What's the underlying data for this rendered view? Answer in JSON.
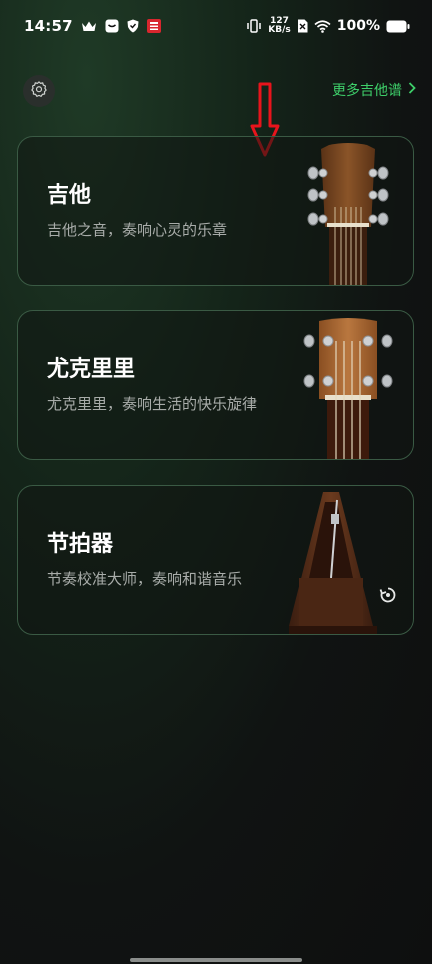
{
  "status_bar": {
    "time": "14:57",
    "net_speed_value": "127",
    "net_speed_unit": "KB/s",
    "battery": "100%"
  },
  "header": {
    "more_tabs_label": "更多吉他谱",
    "chevron": "chevron-right-icon",
    "settings": "gear-icon"
  },
  "cards": [
    {
      "title": "吉他",
      "subtitle": "吉他之音，奏响心灵的乐章",
      "art": "guitar-headstock"
    },
    {
      "title": "尤克里里",
      "subtitle": "尤克里里，奏响生活的快乐旋律",
      "art": "ukulele-headstock"
    },
    {
      "title": "节拍器",
      "subtitle": "节奏校准大师，奏响和谐音乐",
      "art": "metronome"
    }
  ],
  "colors": {
    "accent_green": "#3ecf6a",
    "card_border": "#3a5a44",
    "annotation_red": "#e8141c"
  }
}
